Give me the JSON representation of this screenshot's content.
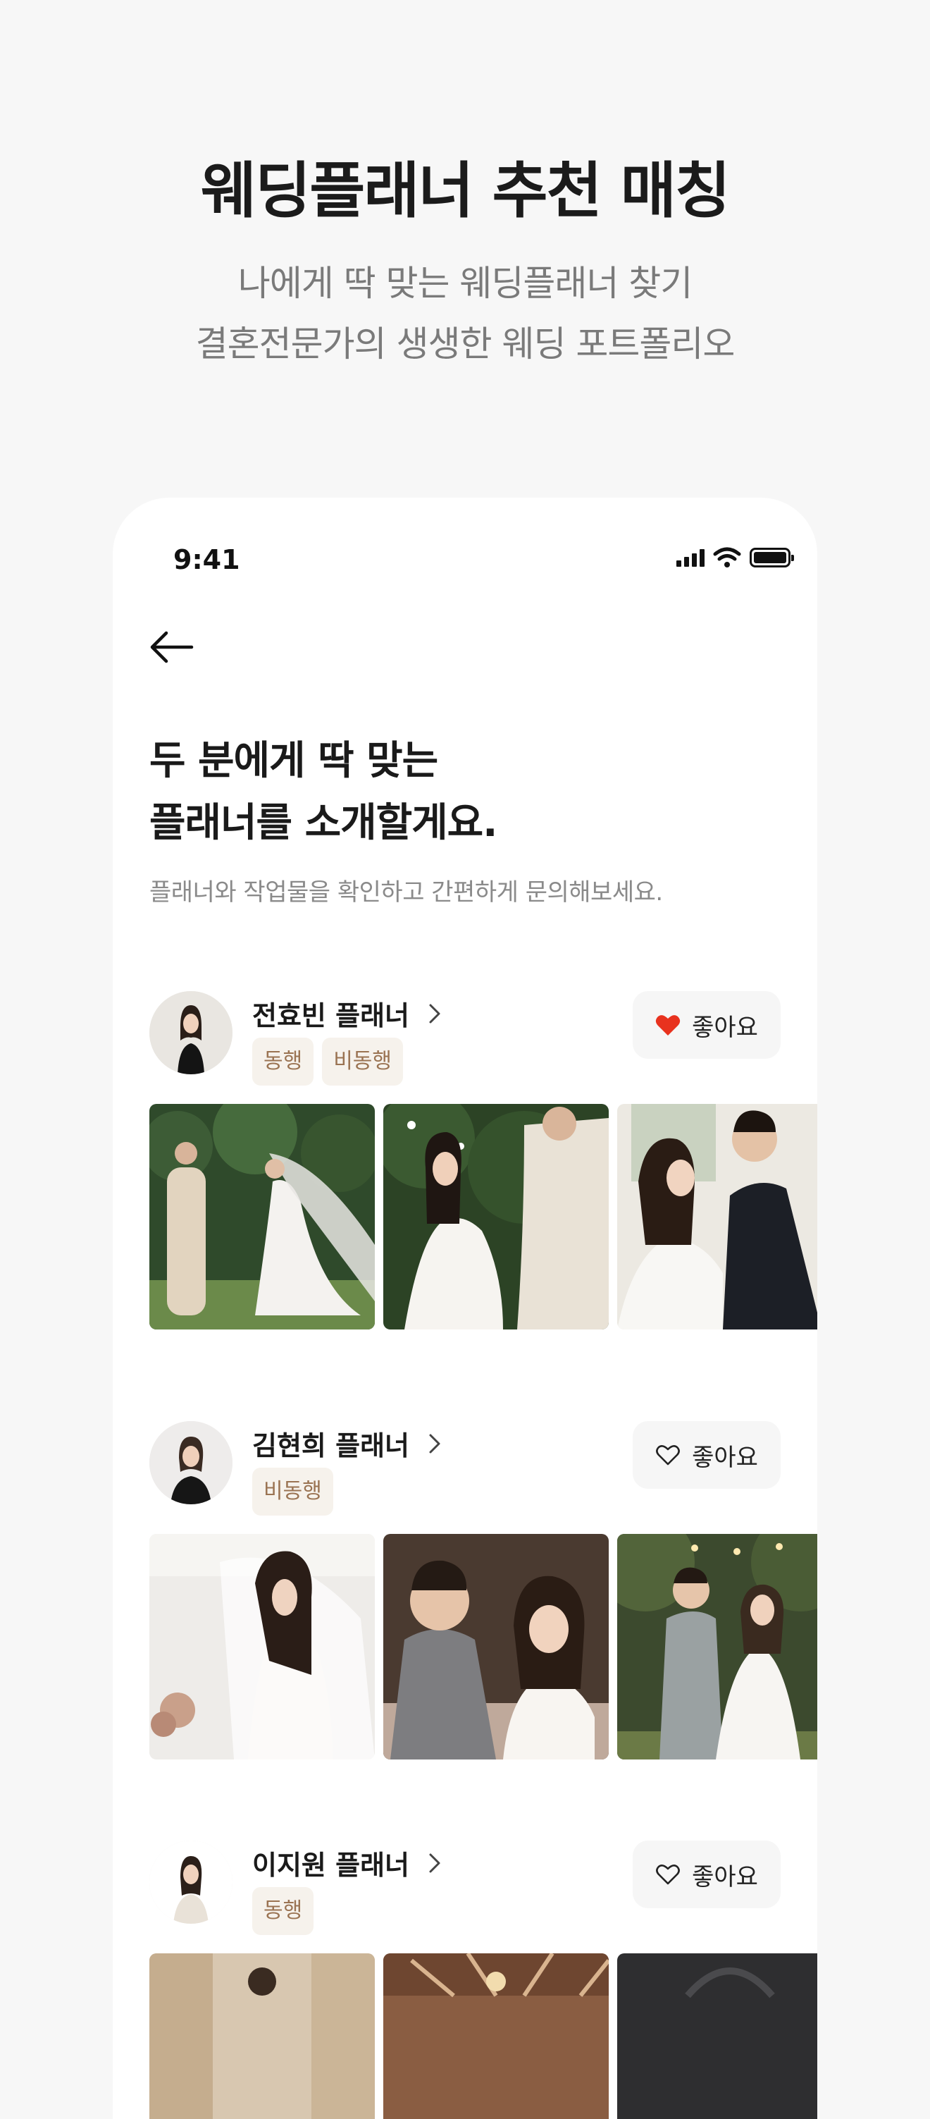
{
  "promo": {
    "title": "웨딩플래너 추천 매칭",
    "subtitle_line1": "나에게 딱 맞는 웨딩플래너 찾기",
    "subtitle_line2": "결혼전문가의 생생한 웨딩 포트폴리오"
  },
  "status_bar": {
    "time": "9:41"
  },
  "header": {
    "title_line1": "두 분에게 딱 맞는",
    "title_line2": "플래너를 소개할게요.",
    "description": "플래너와 작업물을 확인하고 간편하게 문의해보세요."
  },
  "planners": [
    {
      "name": "전효빈 플래너",
      "tags": [
        "동행",
        "비동행"
      ],
      "like_label": "좋아요",
      "liked": true
    },
    {
      "name": "김현희 플래너",
      "tags": [
        "비동행"
      ],
      "like_label": "좋아요",
      "liked": false
    },
    {
      "name": "이지원 플래너",
      "tags": [
        "동행"
      ],
      "like_label": "좋아요",
      "liked": false
    }
  ],
  "colors": {
    "heart_active": "#e8321e",
    "tag_bg": "#f6f2ec",
    "tag_text": "#9a7352",
    "like_bg": "#f6f6f6"
  }
}
